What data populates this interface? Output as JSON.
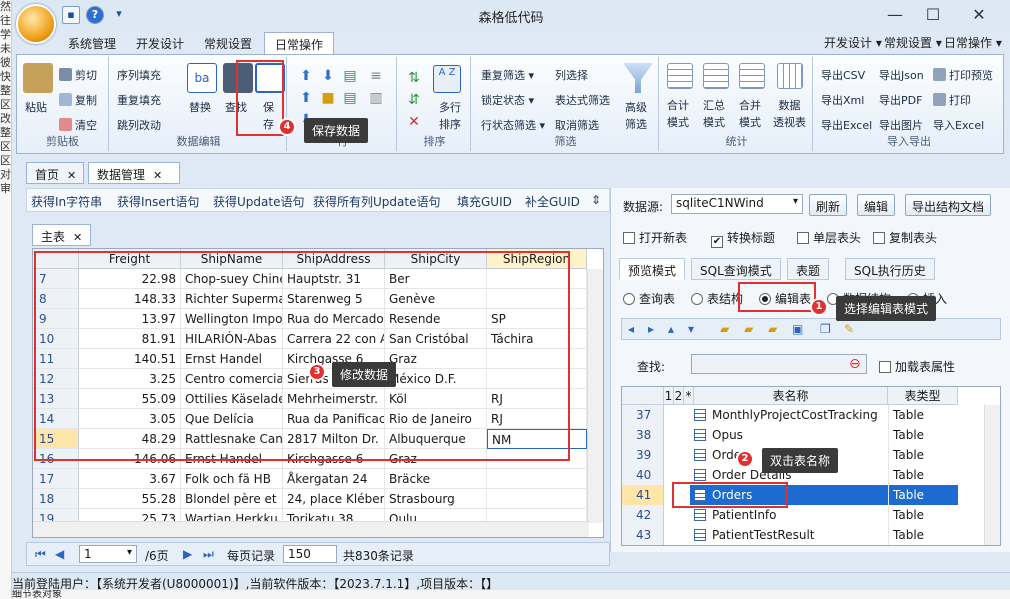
{
  "left_strip": [
    "然",
    "往",
    "学",
    "未",
    "彼",
    "快",
    "整",
    "区",
    "改",
    "整",
    "区",
    "区",
    "对",
    "审"
  ],
  "window": {
    "title": "森格低代码",
    "minimize": "—",
    "maximize": "☐",
    "close": "✕"
  },
  "quick_access": {
    "save_icon": "save-icon",
    "help_icon": "help-icon",
    "customize_icon": "dropdown-icon"
  },
  "menu": {
    "tabs": [
      "系统管理",
      "开发设计",
      "常规设置",
      "日常操作"
    ],
    "right": [
      "开发设计 ▾",
      "常规设置 ▾",
      "日常操作 ▾"
    ]
  },
  "ribbon": {
    "clipboard": {
      "label": "剪贴板",
      "paste": "粘贴",
      "cut": "剪切",
      "copy": "复制",
      "clear": "清空"
    },
    "edit": {
      "label": "数据编辑",
      "fill_seq": "序列填充",
      "fill_repeat": "重复填充",
      "jump_edit": "跳列改动",
      "replace": "替换",
      "find": "查找",
      "save": "保\n存"
    },
    "row": {
      "label": "行"
    },
    "sort": {
      "label": "排序",
      "multi": "多行\n排序"
    },
    "filter": {
      "label": "筛选",
      "dup_filter": "重复筛选 ▾",
      "col_select": "列选择",
      "lock_state": "锁定状态 ▾",
      "expr_filter": "表达式筛选",
      "row_filter": "行状态筛选 ▾",
      "cancel_filter": "取消筛选",
      "advanced": "高级\n筛选"
    },
    "stats": {
      "label": "统计",
      "total": "合计\n模式",
      "summary": "汇总\n模式",
      "merge": "合并\n模式",
      "pivot": "数据\n透视表"
    },
    "export": {
      "label": "导入导出",
      "csv": "导出CSV",
      "json": "导出Json",
      "print_preview": "打印预览",
      "xml": "导出Xml",
      "pdf": "导出PDF",
      "print": "打印",
      "excel": "导出Excel",
      "image": "导出图片",
      "import_excel": "导入Excel"
    }
  },
  "doc_tabs": [
    "首页",
    "数据管理"
  ],
  "sql_bar": [
    "获得In字符串",
    "获得Insert语句",
    "获得Update语句",
    "获得所有列Update语句",
    "填充GUID",
    "补全GUID"
  ],
  "subtab": "主表",
  "grid": {
    "columns": [
      "Freight",
      "ShipName",
      "ShipAddress",
      "ShipCity",
      "ShipRegion"
    ],
    "rows": [
      {
        "n": "7",
        "freight": "22.98",
        "name": "Chop-suey Chine",
        "addr": "Hauptstr. 31",
        "city": "Ber",
        "region": ""
      },
      {
        "n": "8",
        "freight": "148.33",
        "name": "Richter Superma",
        "addr": "Starenweg 5",
        "city": "Genève",
        "region": ""
      },
      {
        "n": "9",
        "freight": "13.97",
        "name": "Wellington Impo",
        "addr": "Rua do Mercado",
        "city": "Resende",
        "region": "SP"
      },
      {
        "n": "10",
        "freight": "81.91",
        "name": "HILARIÓN-Abas",
        "addr": "Carrera 22 con A",
        "city": "San Cristóbal",
        "region": "Táchira"
      },
      {
        "n": "11",
        "freight": "140.51",
        "name": "Ernst Handel",
        "addr": "Kirchgasse 6",
        "city": "Graz",
        "region": ""
      },
      {
        "n": "12",
        "freight": "3.25",
        "name": "Centro comercia",
        "addr": "Sierras de Gran",
        "city": "México D.F.",
        "region": ""
      },
      {
        "n": "13",
        "freight": "55.09",
        "name": "Ottilies Käselade",
        "addr": "Mehrheimerstr.",
        "city": "Köl",
        "region": "RJ"
      },
      {
        "n": "14",
        "freight": "3.05",
        "name": "Que Delícia",
        "addr": "Rua da Panificac",
        "city": "Rio de Janeiro",
        "region": "RJ"
      },
      {
        "n": "15",
        "freight": "48.29",
        "name": "Rattlesnake Can",
        "addr": "2817 Milton Dr.",
        "city": "Albuquerque",
        "region": "NM"
      },
      {
        "n": "16",
        "freight": "146.06",
        "name": "Ernst Handel",
        "addr": "Kirchgasse 6",
        "city": "Graz",
        "region": ""
      },
      {
        "n": "17",
        "freight": "3.67",
        "name": "Folk och fä HB",
        "addr": "Åkergatan 24",
        "city": "Bräcke",
        "region": ""
      },
      {
        "n": "18",
        "freight": "55.28",
        "name": "Blondel père et",
        "addr": "24, place Kléber",
        "city": "Strasbourg",
        "region": ""
      },
      {
        "n": "19",
        "freight": "25.73",
        "name": "Wartian Herkku",
        "addr": "Torikatu 38",
        "city": "Oulu",
        "region": ""
      }
    ]
  },
  "pager": {
    "page": "1",
    "total_pages": "/6页",
    "per_page_label": "每页记录",
    "per_page": "150",
    "total": "共830条记录"
  },
  "right": {
    "datasource_label": "数据源:",
    "datasource": "sqliteC1NWind",
    "refresh": "刷新",
    "edit": "编辑",
    "export_doc": "导出结构文档",
    "opts": [
      "打开新表",
      "转换标题",
      "单层表头",
      "复制表头"
    ],
    "tabs": [
      "预览模式",
      "SQL查询模式",
      "表题",
      "SQL执行历史"
    ],
    "modes": [
      "查询表",
      "表结构",
      "编辑表",
      "数据结构",
      "插入"
    ],
    "search_label": "查找:",
    "load_props": "加载表属性",
    "tree_headers": [
      "1",
      "2",
      "*",
      "表名称",
      "表类型"
    ],
    "tables": [
      {
        "n": "37",
        "name": "MonthlyProjectCostTracking",
        "type": "Table"
      },
      {
        "n": "38",
        "name": "Opus",
        "type": "Table"
      },
      {
        "n": "39",
        "name": "Order",
        "type": "Table"
      },
      {
        "n": "40",
        "name": "Order Details",
        "type": "Table"
      },
      {
        "n": "41",
        "name": "Orders",
        "type": "Table"
      },
      {
        "n": "42",
        "name": "PatientInfo",
        "type": "Table"
      },
      {
        "n": "43",
        "name": "PatientTestResult",
        "type": "Table"
      }
    ]
  },
  "callouts": {
    "c1": {
      "num": "1",
      "text": "选择编辑表模式"
    },
    "c2": {
      "num": "2",
      "text": "双击表名称"
    },
    "c3": {
      "num": "3",
      "text": "修改数据"
    },
    "c4": {
      "num": "4",
      "text": "保存数据"
    }
  },
  "status": "当前登陆用户：【系统开发者(U8000001)】,当前软件版本：【2023.7.1.1】,项目版本：【】",
  "bottom_strip": "细节表对象",
  "colors": {
    "accent_red": "#e03030",
    "selection_blue": "#1c6bd0",
    "ribbon_border": "#9bb3d6"
  }
}
